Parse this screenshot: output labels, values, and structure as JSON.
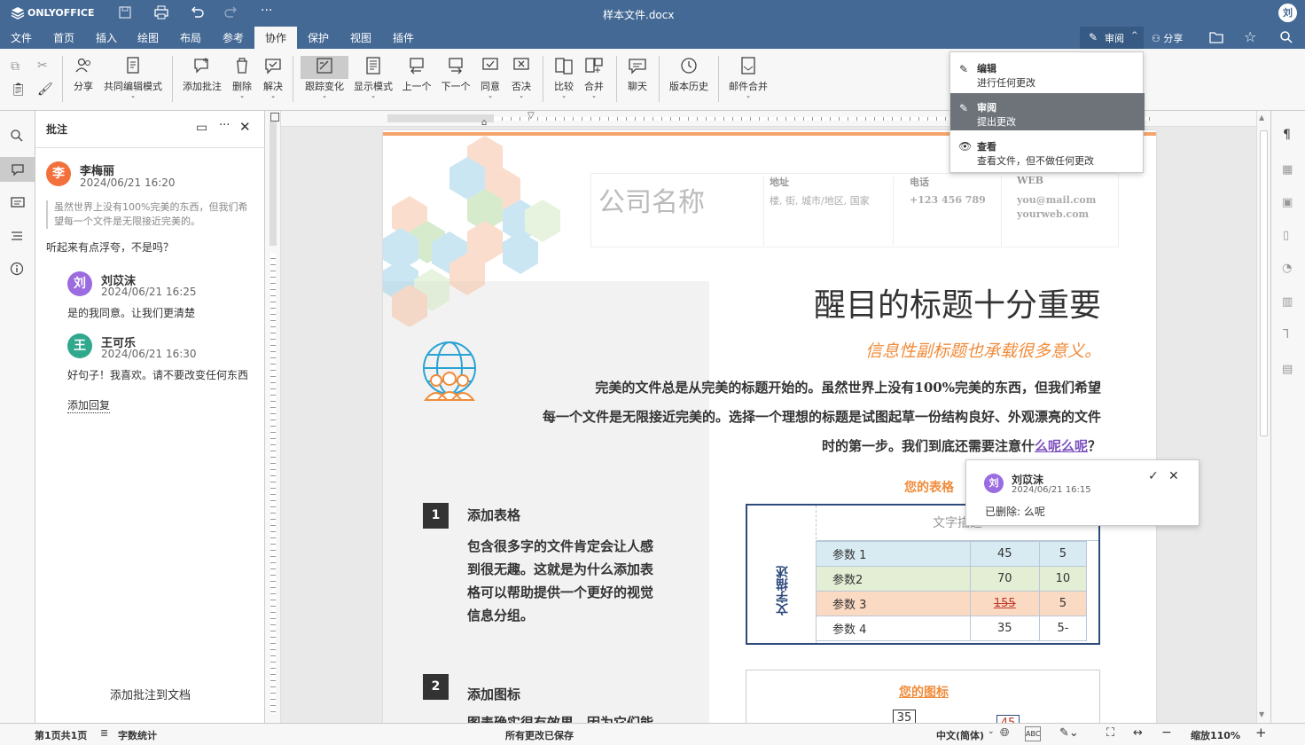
{
  "app": {
    "name": "ONLYOFFICE",
    "file_title": "样本文件.docx",
    "user_initial": "刘"
  },
  "menu": {
    "items": [
      "文件",
      "首页",
      "插入",
      "绘图",
      "布局",
      "参考",
      "协作",
      "保护",
      "视图",
      "插件"
    ],
    "active": "协作",
    "review_label": "审阅",
    "share_label": "分享"
  },
  "toolbar": {
    "buttons": [
      "分享",
      "共同编辑模式",
      "添加批注",
      "删除",
      "解决",
      "跟踪变化",
      "显示模式",
      "上一个",
      "下一个",
      "同意",
      "否决",
      "比较",
      "合并",
      "聊天",
      "版本历史",
      "邮件合并"
    ]
  },
  "mode_menu": {
    "items": [
      {
        "title": "编辑",
        "desc": "进行任何更改"
      },
      {
        "title": "审阅",
        "desc": "提出更改"
      },
      {
        "title": "查看",
        "desc": "查看文件，但不做任何更改"
      }
    ],
    "selected": "审阅"
  },
  "comments_panel": {
    "title": "批注",
    "add_to_doc": "添加批注到文档",
    "main": {
      "initial": "李",
      "author": "李梅丽",
      "time": "2024/06/21  16:20",
      "quote": "虽然世界上没有100%完美的东西，但我们希望每一个文件是无限接近完美的。",
      "text": "听起来有点浮夸，不是吗？"
    },
    "replies": [
      {
        "initial": "刘",
        "author": "刘苡沫",
        "time": "2024/06/21  16:25",
        "text": "是的我同意。让我们更清楚"
      },
      {
        "initial": "王",
        "author": "王可乐",
        "time": "2024/06/21  16:30",
        "text": "好句子！我喜欢。请不要改变任何东西"
      }
    ],
    "add_reply": "添加回复"
  },
  "document": {
    "company": "公司名称",
    "header_cols": [
      {
        "label": "地址",
        "value": "楼, 街, 城市/地区, 国家"
      },
      {
        "label": "电话",
        "value": "+123 456 789"
      },
      {
        "label": "WEB",
        "value": "you@mail.com",
        "value2": "yourweb.com"
      }
    ],
    "title": "醒目的标题十分重要",
    "subtitle": "信息性副标题也承载很多意义。",
    "para_line1": "完美的文件总是从完美的标题开始的。虽然世界上没有100%完美的东西，但我们希望",
    "para_line2": "每一个文件是无限接近完美的。选择一个理想的标题是试图起草一份结构良好、外观漂亮的文件",
    "para_line3a": "时的第一步。我们到底还需要注意什",
    "para_inserted": "么呢么呢",
    "para_end": "？",
    "section1": {
      "num": "1",
      "heading": "添加表格",
      "lines": [
        "包含很多字的文件肯定会让人感",
        "到很无趣。这就是为什么添加表",
        "格可以帮助提供一个更好的视觉",
        "信息分组。"
      ]
    },
    "section2": {
      "num": "2",
      "heading": "添加图标",
      "partial": "图表确实很有效果，因为它们能"
    },
    "table_title": "您的表格",
    "table_header": "文字描述",
    "table_side": "文字描述",
    "table_rows": [
      {
        "label": "参数 1",
        "a": "45",
        "b": "5",
        "color": "#d9ebf2"
      },
      {
        "label": "参数2",
        "a": "70",
        "b": "10",
        "color": "#e3eed5"
      },
      {
        "label": "参数 3",
        "a": "155",
        "b": "5",
        "color": "#fbdac4"
      },
      {
        "label": "参数 4",
        "a": "35",
        "b": "5-",
        "color": "#ffffff"
      }
    ],
    "chart_title": "您的图标",
    "chart_labels": [
      "35",
      "45"
    ]
  },
  "change_popup": {
    "initial": "刘",
    "author": "刘苡沫",
    "time": "2024/06/21  16:15",
    "label": "已删除:",
    "deleted": "么呢"
  },
  "status": {
    "page": "第1页共1页",
    "word_count": "字数统计",
    "saved": "所有更改已保存",
    "language": "中文(简体)",
    "zoom": "缩放110%"
  },
  "colors": {
    "header": "#446995",
    "accent": "#f08c3a",
    "avatar_li": "#f36f3c",
    "avatar_liu": "#9b6be0",
    "avatar_wang": "#2fa88d"
  }
}
